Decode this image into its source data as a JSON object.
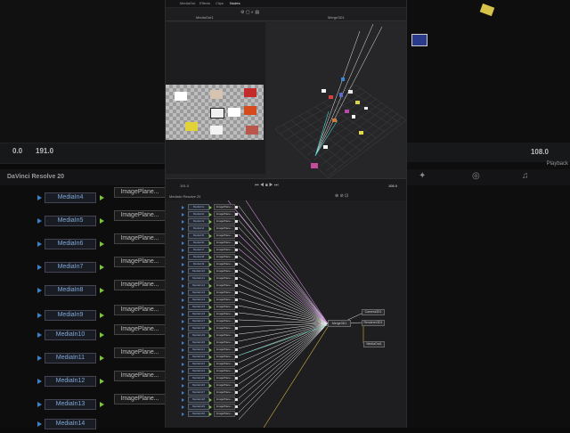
{
  "background_app": {
    "brand": "DaVinci Resolve 20",
    "ruler": {
      "start": "0.0",
      "end": "191.0"
    },
    "right_timecode": "108.0",
    "right_label": "Playback",
    "media_nodes": [
      "MediaIn4",
      "MediaIn5",
      "MediaIn6",
      "MediaIn7",
      "MediaIn8",
      "MediaIn9",
      "MediaIn10",
      "MediaIn11",
      "MediaIn12",
      "MediaIn13",
      "MediaIn14"
    ],
    "plane_label": "ImagePlane..."
  },
  "window": {
    "menu": [
      "MediaOut",
      "Effects",
      "Clips",
      "Nodes"
    ],
    "viewer_labels": {
      "left": "MediaOut1",
      "right": "Merge3D1",
      "perspective": "Perspective"
    },
    "timeline": {
      "start": "191.0",
      "end": "108.0"
    },
    "node_editor_title": "MediaIn Resolve 20",
    "node_rows": [
      "MediaIn1",
      "MediaIn2",
      "MediaIn3",
      "MediaIn4",
      "MediaIn5",
      "MediaIn6",
      "MediaIn7",
      "MediaIn8",
      "MediaIn9",
      "MediaIn10",
      "MediaIn11",
      "MediaIn12",
      "MediaIn13",
      "MediaIn14",
      "MediaIn15",
      "MediaIn16",
      "MediaIn17",
      "MediaIn18",
      "MediaIn19",
      "MediaIn20",
      "MediaIn21",
      "MediaIn22",
      "MediaIn23",
      "MediaIn24",
      "MediaIn25",
      "MediaIn26",
      "MediaIn27",
      "MediaIn28",
      "MediaIn29",
      "MediaIn30"
    ],
    "plane_label": "ImagePlane...",
    "hub": {
      "merge": "Merge3D1",
      "renderer": "Renderer3D1",
      "camera": "Camera3D1",
      "out": "MediaOut1"
    }
  },
  "colors": {
    "blue": "#3d85cc",
    "green": "#7dc33f",
    "yellow": "#d6b23a",
    "pink": "#c78bd6",
    "white": "#e6e6e6"
  }
}
